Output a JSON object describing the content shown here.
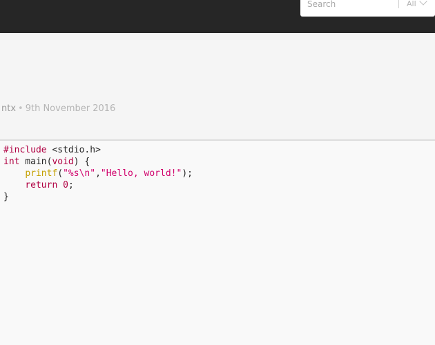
{
  "search": {
    "placeholder": "Search",
    "scope": "All"
  },
  "post": {
    "author": "ntx",
    "separator": "•",
    "date": "9th November 2016"
  },
  "code": {
    "line1": {
      "directive": "#include",
      "header": " <stdio.h>"
    },
    "line2": {
      "type": "int",
      "name": " main(",
      "param": "void",
      "close": ") {"
    },
    "line3": {
      "indent": "    ",
      "fn": "printf",
      "open": "(",
      "fmt": "\"%s\\n\"",
      "comma": ",",
      "arg": "\"Hello, world!\"",
      "close": ");"
    },
    "line4": {
      "indent": "    ",
      "kw": "return",
      "space": " ",
      "num": "0",
      "semi": ";"
    },
    "line5": {
      "brace": "}"
    }
  },
  "colors": {
    "topbar": "#262626",
    "keyword": "#b00042",
    "function": "#c4a000",
    "string": "#d0006b"
  }
}
